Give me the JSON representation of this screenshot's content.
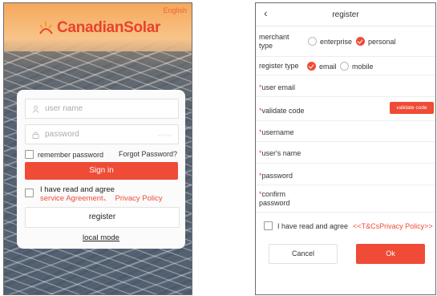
{
  "login": {
    "language": "English",
    "brand": "CanadianSolar",
    "username_placeholder": "user name",
    "password_placeholder": "password",
    "remember_label": "remember password",
    "forgot_label": "Forgot Password?",
    "signin_label": "Sign in",
    "agree_prefix": "I have read and agree",
    "service_agreement": "service Agreement",
    "separator": "、",
    "privacy_policy": "Privacy Policy",
    "register_label": "register",
    "local_mode": "local mode",
    "colors": {
      "accent": "#ef4b36",
      "brand": "#e8432a"
    }
  },
  "register": {
    "title": "register",
    "back_icon": "chevron-left-icon",
    "merchant_type_label": "merchant type",
    "merchant_options": [
      {
        "label": "enterprise",
        "selected": false
      },
      {
        "label": "personal",
        "selected": true
      }
    ],
    "register_type_label": "register type",
    "register_options": [
      {
        "label": "email",
        "selected": true
      },
      {
        "label": "mobile",
        "selected": false
      }
    ],
    "required_mark": "*",
    "fields": {
      "user_email": "user email",
      "validate_code": "validate code",
      "username": "username",
      "users_name": "user's name",
      "password": "password",
      "confirm_password": "confirm password"
    },
    "validate_code_button": "validate code",
    "agree_prefix": "I have read and agree",
    "agree_link": "<<T&CsPrivacy Policy>>",
    "cancel_label": "Cancel",
    "ok_label": "Ok"
  }
}
